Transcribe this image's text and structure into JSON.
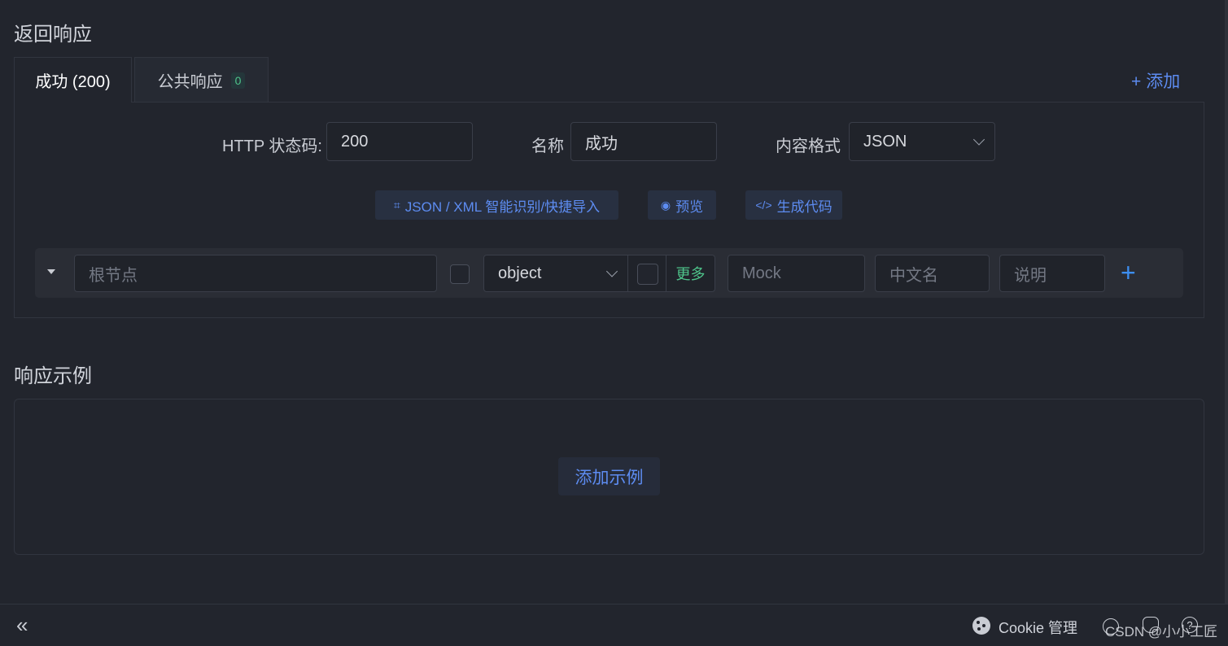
{
  "response_section": {
    "title": "返回响应",
    "tabs": [
      {
        "label": "成功 (200)",
        "active": true
      },
      {
        "label": "公共响应",
        "count": "0",
        "active": false
      }
    ],
    "add_label": "添加"
  },
  "form": {
    "status_label": "HTTP 状态码:",
    "status_value": "200",
    "name_label": "名称",
    "name_value": "成功",
    "format_label": "内容格式",
    "format_value": "JSON"
  },
  "actions": {
    "import_label": "JSON / XML 智能识别/快捷导入",
    "preview_label": "预览",
    "codegen_label": "生成代码"
  },
  "schema_row": {
    "root_placeholder": "根节点",
    "type_value": "object",
    "more_label": "更多",
    "mock_placeholder": "Mock",
    "cn_name_placeholder": "中文名",
    "desc_placeholder": "说明"
  },
  "example_section": {
    "title": "响应示例",
    "add_example_label": "添加示例"
  },
  "footer": {
    "cookie_label": "Cookie 管理",
    "watermark": "CSDN @小小工匠"
  },
  "colors": {
    "background": "#22252d",
    "accent": "#5d8cf1",
    "success": "#4ec38a"
  }
}
